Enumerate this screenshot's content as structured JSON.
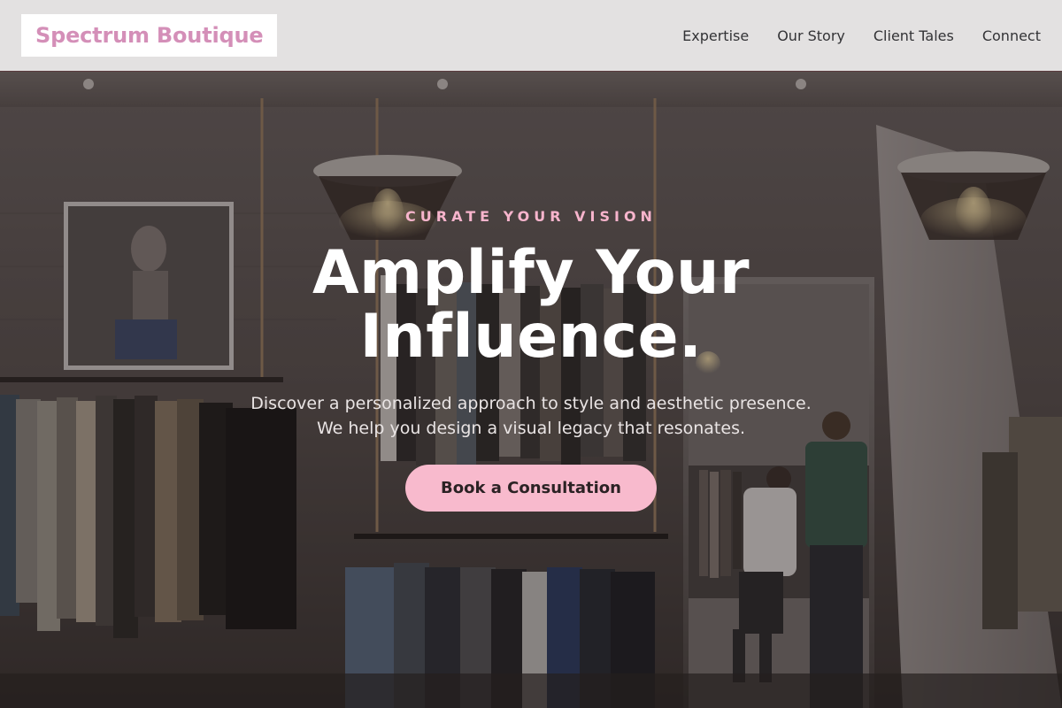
{
  "brand": {
    "name": "Spectrum Boutique",
    "accent_color": "#d48fb8"
  },
  "nav": {
    "items": [
      {
        "label": "Expertise"
      },
      {
        "label": "Our Story"
      },
      {
        "label": "Client Tales"
      },
      {
        "label": "Connect"
      }
    ]
  },
  "hero": {
    "eyebrow": "CURATE YOUR VISION",
    "headline": "Amplify Your Influence.",
    "subtext_line1": "Discover a personalized approach to style and aesthetic presence.",
    "subtext_line2": "We help you design a visual legacy that resonates.",
    "cta_label": "Book a Consultation",
    "cta_color": "#f8bacd",
    "background_image": "boutique clothing store interior with hanging lamps and clothing racks"
  }
}
